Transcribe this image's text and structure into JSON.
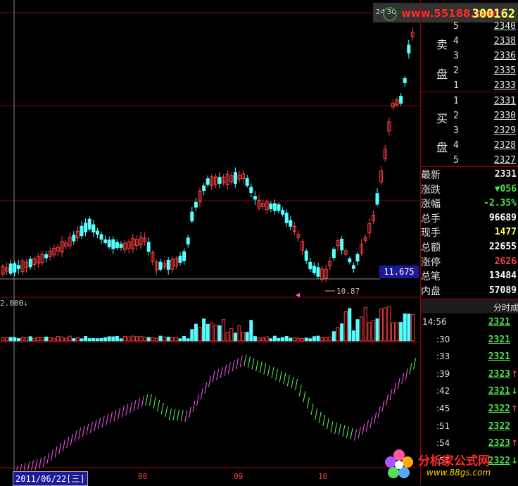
{
  "header": {
    "watermark_left": "24 30",
    "watermark_url": "www.55188.com",
    "stock_code": "300162"
  },
  "order_book": {
    "sell_label_top": "卖",
    "sell_label_bottom": "盘",
    "buy_label_top": "买",
    "buy_label_bottom": "盘",
    "sell": [
      {
        "level": "5",
        "price": "2340"
      },
      {
        "level": "4",
        "price": "2338"
      },
      {
        "level": "3",
        "price": "2336"
      },
      {
        "level": "2",
        "price": "2335"
      },
      {
        "level": "1",
        "price": "2333"
      }
    ],
    "buy": [
      {
        "level": "1",
        "price": "2331"
      },
      {
        "level": "2",
        "price": "2330"
      },
      {
        "level": "3",
        "price": "2329"
      },
      {
        "level": "4",
        "price": "2328"
      },
      {
        "level": "5",
        "price": "2327"
      }
    ]
  },
  "quote": [
    {
      "label": "最新",
      "value": "2331",
      "color": "#e8e8e8"
    },
    {
      "label": "涨跌",
      "value": "▼056",
      "color": "#4ce04c"
    },
    {
      "label": "涨幅",
      "value": "-2.35%",
      "color": "#4ce04c"
    },
    {
      "label": "总手",
      "value": "96689",
      "color": "#ffffff"
    },
    {
      "label": "现手",
      "value": "1477",
      "color": "#ffff55"
    },
    {
      "label": "总额",
      "value": "22655",
      "color": "#ffffff"
    },
    {
      "label": "涨停",
      "value": "2626",
      "color": "#ff4040"
    },
    {
      "label": "总笔",
      "value": "13484",
      "color": "#ffffff"
    },
    {
      "label": "内盘",
      "value": "57089",
      "color": "#ffffff"
    }
  ],
  "ticks_header": "分时成",
  "ticks": [
    {
      "time": "14:56",
      "price": "2321",
      "arrow": ""
    },
    {
      "time": ":30",
      "price": "2321",
      "arrow": ""
    },
    {
      "time": ":33",
      "price": "2321",
      "arrow": ""
    },
    {
      "time": ":39",
      "price": "2323",
      "arrow": "up"
    },
    {
      "time": ":42",
      "price": "2321",
      "arrow": "down"
    },
    {
      "time": ":45",
      "price": "2322",
      "arrow": "up"
    },
    {
      "time": ":51",
      "price": "2322",
      "arrow": ""
    },
    {
      "time": ":54",
      "price": "2323",
      "arrow": "up"
    },
    {
      "time": ":57",
      "price": "2322",
      "arrow": "down"
    }
  ],
  "chart": {
    "current_price_tag": "11.675",
    "low_marker": "10.87",
    "volume_scale_label": "2.000",
    "date_label": "2011/06/22[三]",
    "month_labels": [
      "08",
      "09",
      "10"
    ]
  },
  "logo": {
    "name": "分析家公式网",
    "url": "www.88gs.com"
  },
  "colors": {
    "up": "#ff4040",
    "down": "#55ffff",
    "macd_up": "#ff55ff",
    "macd_down": "#55ff55",
    "grid": "#a00000"
  },
  "chart_data": {
    "type": "candlestick",
    "low_price": 10.87,
    "current_price": 11.675,
    "volume_axis_max": 2.0,
    "months": [
      "08",
      "09",
      "10"
    ]
  }
}
